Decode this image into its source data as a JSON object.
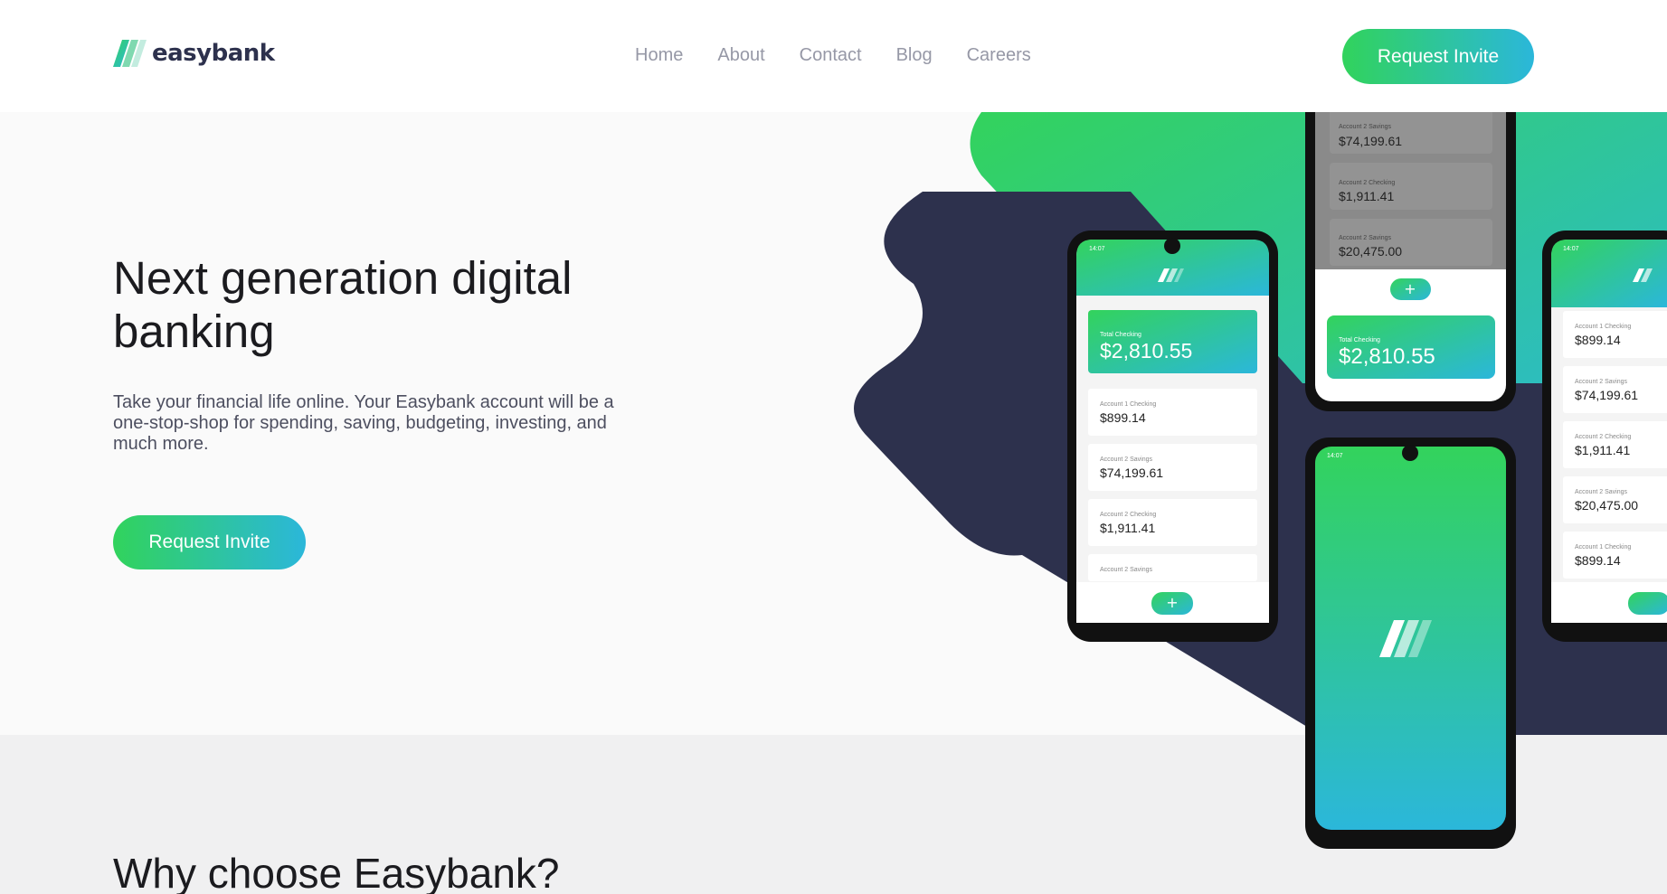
{
  "brand": {
    "name": "easybank",
    "accent_gradient": [
      "#31d35c",
      "#2bb7da"
    ],
    "dark_navy": "#2d314d"
  },
  "nav": {
    "items": [
      "Home",
      "About",
      "Contact",
      "Blog",
      "Careers"
    ]
  },
  "header": {
    "cta_label": "Request Invite"
  },
  "hero": {
    "title": "Next generation digital banking",
    "text": "Take your financial life online. Your Easybank account will be a one-stop-shop for spending, saving, budgeting, investing, and much more.",
    "cta_label": "Request Invite"
  },
  "phones": {
    "status_time": "14:07",
    "total_label": "Total Checking",
    "total_value": "$2,810.55",
    "accounts": [
      {
        "label": "Account 1 Checking",
        "value": "$899.14"
      },
      {
        "label": "Account 2 Savings",
        "value": "$74,199.61"
      },
      {
        "label": "Account 2 Checking",
        "value": "$1,911.41"
      },
      {
        "label": "Account 2 Savings",
        "value": "$20,475.00"
      }
    ]
  },
  "why": {
    "title": "Why choose Easybank?"
  }
}
